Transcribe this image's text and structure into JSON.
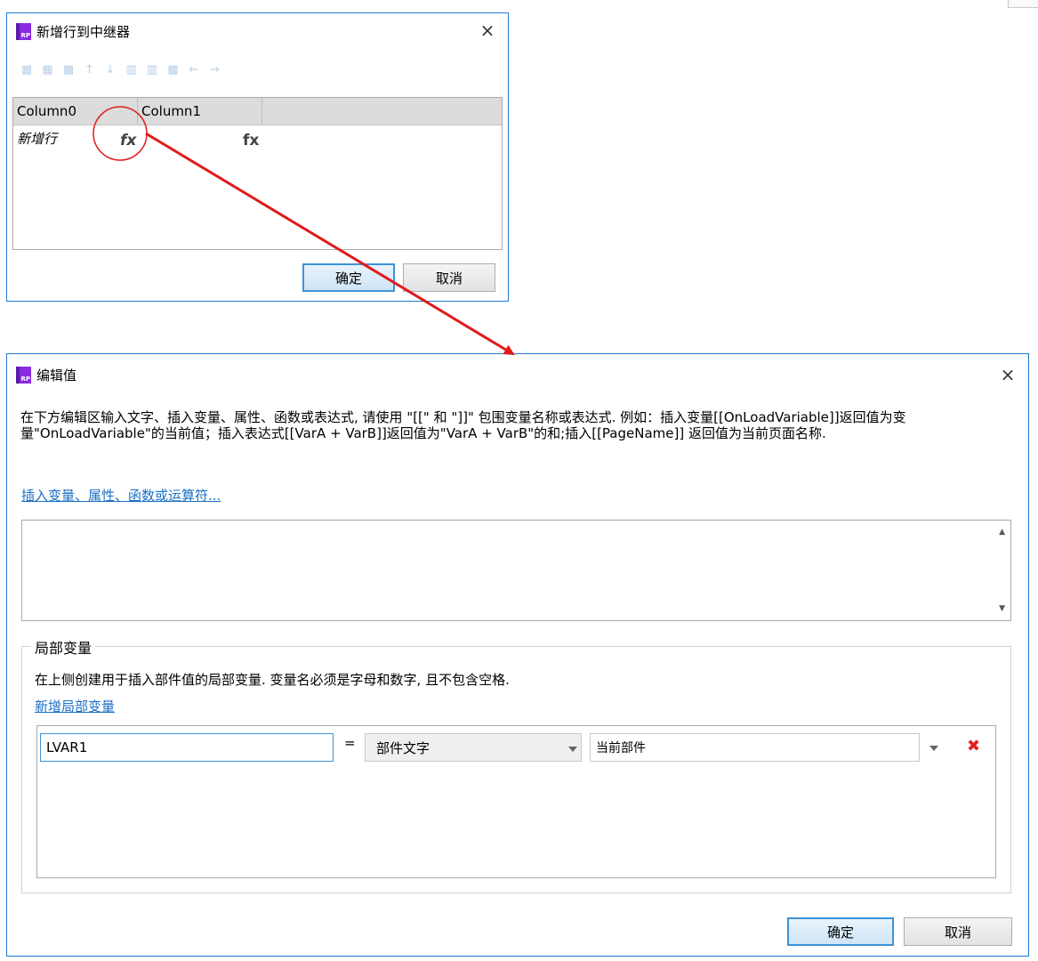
{
  "dialog1": {
    "title": "新增行到中继器",
    "close": "×",
    "columns": [
      "Column0",
      "Column1"
    ],
    "row": {
      "cell0": "新增行",
      "fx": "fx"
    },
    "ok": "确定",
    "cancel": "取消",
    "toolbar_icons": [
      "insert-row-above-icon",
      "insert-row-below-icon",
      "delete-row-icon",
      "move-up-icon",
      "move-down-icon",
      "insert-col-left-icon",
      "insert-col-right-icon",
      "delete-col-icon",
      "move-left-icon",
      "move-right-icon"
    ]
  },
  "dialog2": {
    "title": "编辑值",
    "close": "×",
    "description": "在下方编辑区输入文字、插入变量、属性、函数或表达式, 请使用 \"[[\" 和 \"]]\" 包围变量名称或表达式. 例如：插入变量[[OnLoadVariable]]返回值为变量\"OnLoadVariable\"的当前值；插入表达式[[VarA + VarB]]返回值为\"VarA + VarB\"的和;插入[[PageName]] 返回值为当前页面名称.",
    "insert_link": "插入变量、属性、函数或运算符...",
    "editor_value": "",
    "local_vars": {
      "legend": "局部变量",
      "text": "在上侧创建用于插入部件值的局部变量. 变量名必须是字母和数字, 且不包含空格.",
      "add_link": "新增局部变量",
      "row": {
        "name": "LVAR1",
        "equals": "=",
        "type": "部件文字",
        "target": "当前部件",
        "delete": "✖"
      }
    },
    "ok": "确定",
    "cancel": "取消"
  },
  "app_icon_text": "RP",
  "colors": {
    "accent": "#1f7ad6",
    "annotation": "#e11a1a",
    "delete": "#e02020",
    "link": "#1a6fc4"
  }
}
